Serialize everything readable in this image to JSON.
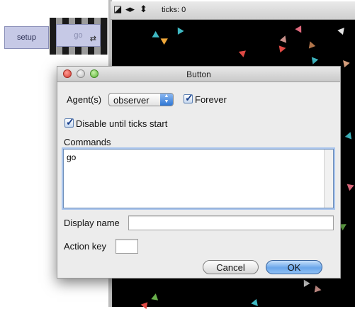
{
  "interface": {
    "setup_label": "setup",
    "go_label": "go",
    "forever_icon_glyph": "⇄"
  },
  "view_toolbar": {
    "ticks_label": "ticks: 0"
  },
  "dialog": {
    "title": "Button",
    "agents_label": "Agent(s)",
    "agents_value": "observer",
    "forever_label": "Forever",
    "forever_checked": true,
    "disable_label": "Disable until ticks start",
    "disable_checked": true,
    "commands_label": "Commands",
    "commands_value": "go",
    "display_name_label": "Display name",
    "display_name_value": "",
    "action_key_label": "Action key",
    "action_key_value": "",
    "cancel_label": "Cancel",
    "ok_label": "OK"
  },
  "colors": {
    "button_face": "#c6c9e6",
    "world_background": "#000000",
    "default_button_blue": "#6aa6ea"
  }
}
